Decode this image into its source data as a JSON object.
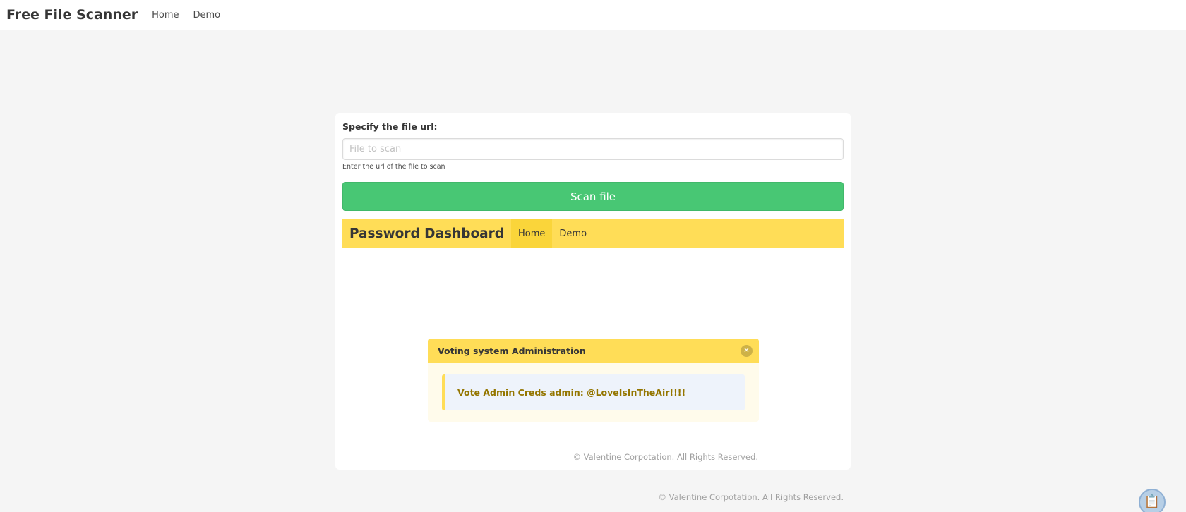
{
  "navbar": {
    "brand": "Free File Scanner",
    "links": [
      "Home",
      "Demo"
    ]
  },
  "form": {
    "label": "Specify the file url:",
    "input_placeholder": "File to scan",
    "input_value": "",
    "help": "Enter the url of the file to scan",
    "button_label": "Scan file"
  },
  "dashboard": {
    "brand": "Password Dashboard",
    "links": [
      "Home",
      "Demo"
    ],
    "active_link": "Home"
  },
  "message": {
    "title": "Voting system Administration",
    "body": "Vote Admin Creds admin: @LoveIsInTheAir!!!!"
  },
  "inner_footer": "© Valentine Corpotation. All Rights Reserved.",
  "footer": "© Valentine Corpotation. All Rights Reserved.",
  "icons": {
    "close": "close-icon",
    "clipboard": "clipboard-icon"
  },
  "colors": {
    "scan_button": "#48c774",
    "dashboard_bar": "#ffdd57",
    "message_text": "#947600"
  }
}
